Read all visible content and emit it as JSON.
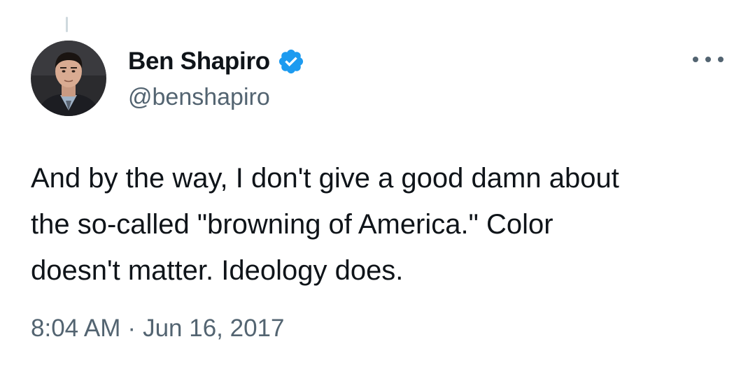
{
  "tweet": {
    "author": {
      "display_name": "Ben Shapiro",
      "handle": "@benshapiro",
      "verified": true,
      "verified_icon": "verified-badge-icon",
      "verified_color": "#1d9bf0",
      "avatar": "profile-photo"
    },
    "more_icon": "more-horizontal-icon",
    "text": "And by the way, I don't give a good damn about\nthe so-called \"browning of America.\" Color\ndoesn't matter. Ideology does.",
    "time": "8:04 AM",
    "separator": "·",
    "date": "Jun 16, 2017"
  },
  "colors": {
    "text_primary": "#0f1419",
    "text_secondary": "#536471",
    "accent": "#1d9bf0",
    "thread_line": "#cfd9de"
  }
}
